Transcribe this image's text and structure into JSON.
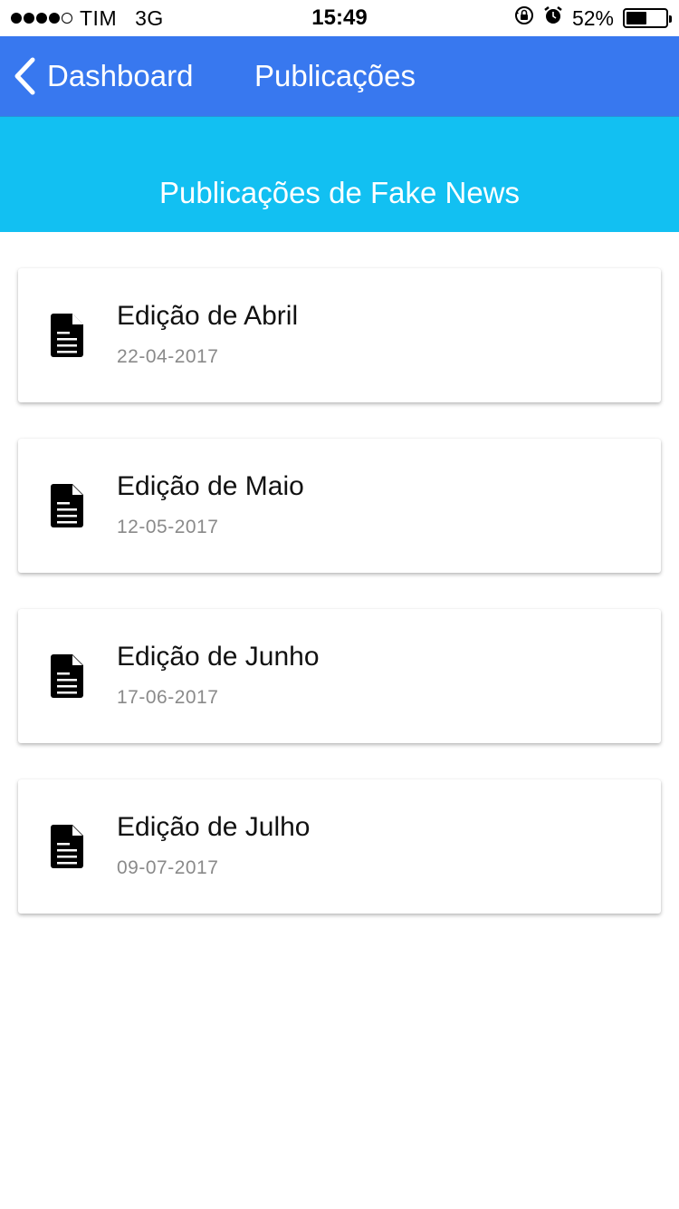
{
  "status_bar": {
    "carrier": "TIM",
    "network": "3G",
    "time": "15:49",
    "battery_percent_label": "52%",
    "battery_level": 0.52,
    "icons": [
      "orientation-lock-icon",
      "alarm-icon",
      "battery-icon"
    ]
  },
  "nav": {
    "back_label": "Dashboard",
    "title": "Publicações"
  },
  "banner": {
    "title": "Publicações de Fake News"
  },
  "publications": [
    {
      "title": "Edição de Abril",
      "date": "22-04-2017",
      "icon": "document-icon"
    },
    {
      "title": "Edição de Maio",
      "date": "12-05-2017",
      "icon": "document-icon"
    },
    {
      "title": "Edição de Junho",
      "date": "17-06-2017",
      "icon": "document-icon"
    },
    {
      "title": "Edição de Julho",
      "date": "09-07-2017",
      "icon": "document-icon"
    }
  ],
  "colors": {
    "nav_bar": "#3878ef",
    "banner": "#12c0f2",
    "date_text": "#8a8a8a"
  }
}
